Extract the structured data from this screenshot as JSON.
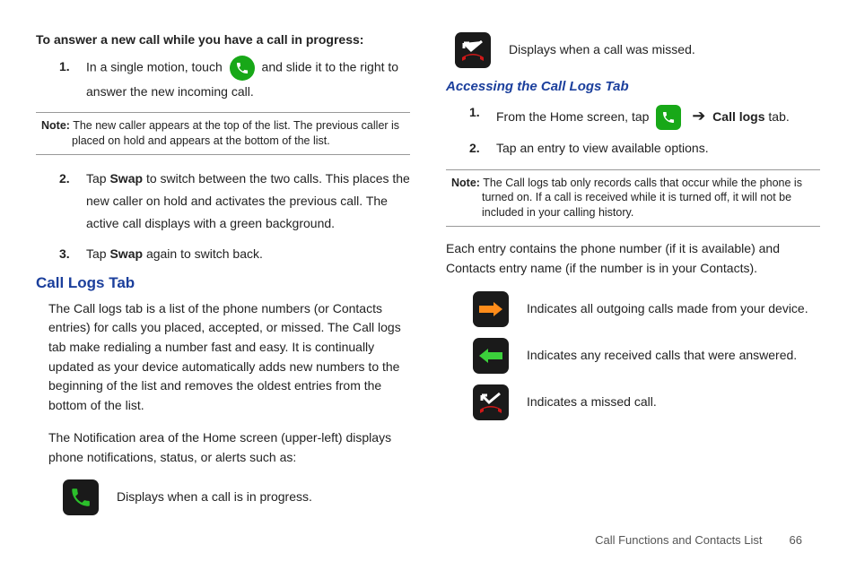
{
  "left": {
    "heading": "To answer a new call while you have a call in progress:",
    "step1_a": "In a single motion, touch",
    "step1_b": "and slide it to the right to answer the new incoming call.",
    "note1_label": "Note:",
    "note1": "The new caller appears at the top of the list. The previous caller is placed on hold and appears at the bottom of the list.",
    "step2_a": "Tap",
    "step2_swap": "Swap",
    "step2_b": "to switch between the two calls. This places the new caller on hold and activates the previous call. The active call displays with a green background.",
    "step3_a": "Tap",
    "step3_swap": "Swap",
    "step3_b": "again to switch back.",
    "h2": "Call Logs Tab",
    "p1": "The Call logs tab is a list of the phone numbers (or Contacts entries) for calls you placed, accepted, or missed. The Call logs tab make redialing a number fast and easy. It is continually updated as your device automatically adds new numbers to the beginning of the list and removes the oldest entries from the bottom of the list.",
    "p2": "The Notification area of the Home screen (upper-left) displays phone notifications, status, or alerts such as:",
    "icon_inprogress": "Displays when a call is in progress."
  },
  "right": {
    "icon_missed": "Displays when a call was missed.",
    "h3": "Accessing the Call Logs Tab",
    "step1_a": "From the Home screen, tap",
    "step1_b": "Call logs",
    "step1_c": "tab.",
    "step2": "Tap an entry to view available options.",
    "note_label": "Note:",
    "note": "The Call logs tab only records calls that occur while the phone is turned on. If a call is received while it is turned off, it will not be included in your calling history.",
    "p1": "Each entry contains the phone number (if it is available) and Contacts entry name (if the number is in your Contacts).",
    "icon_out": "Indicates all outgoing calls made from your device.",
    "icon_in": "Indicates any received calls that were answered.",
    "icon_miss": "Indicates a missed call."
  },
  "footer": {
    "section": "Call Functions and Contacts List",
    "page": "66"
  }
}
